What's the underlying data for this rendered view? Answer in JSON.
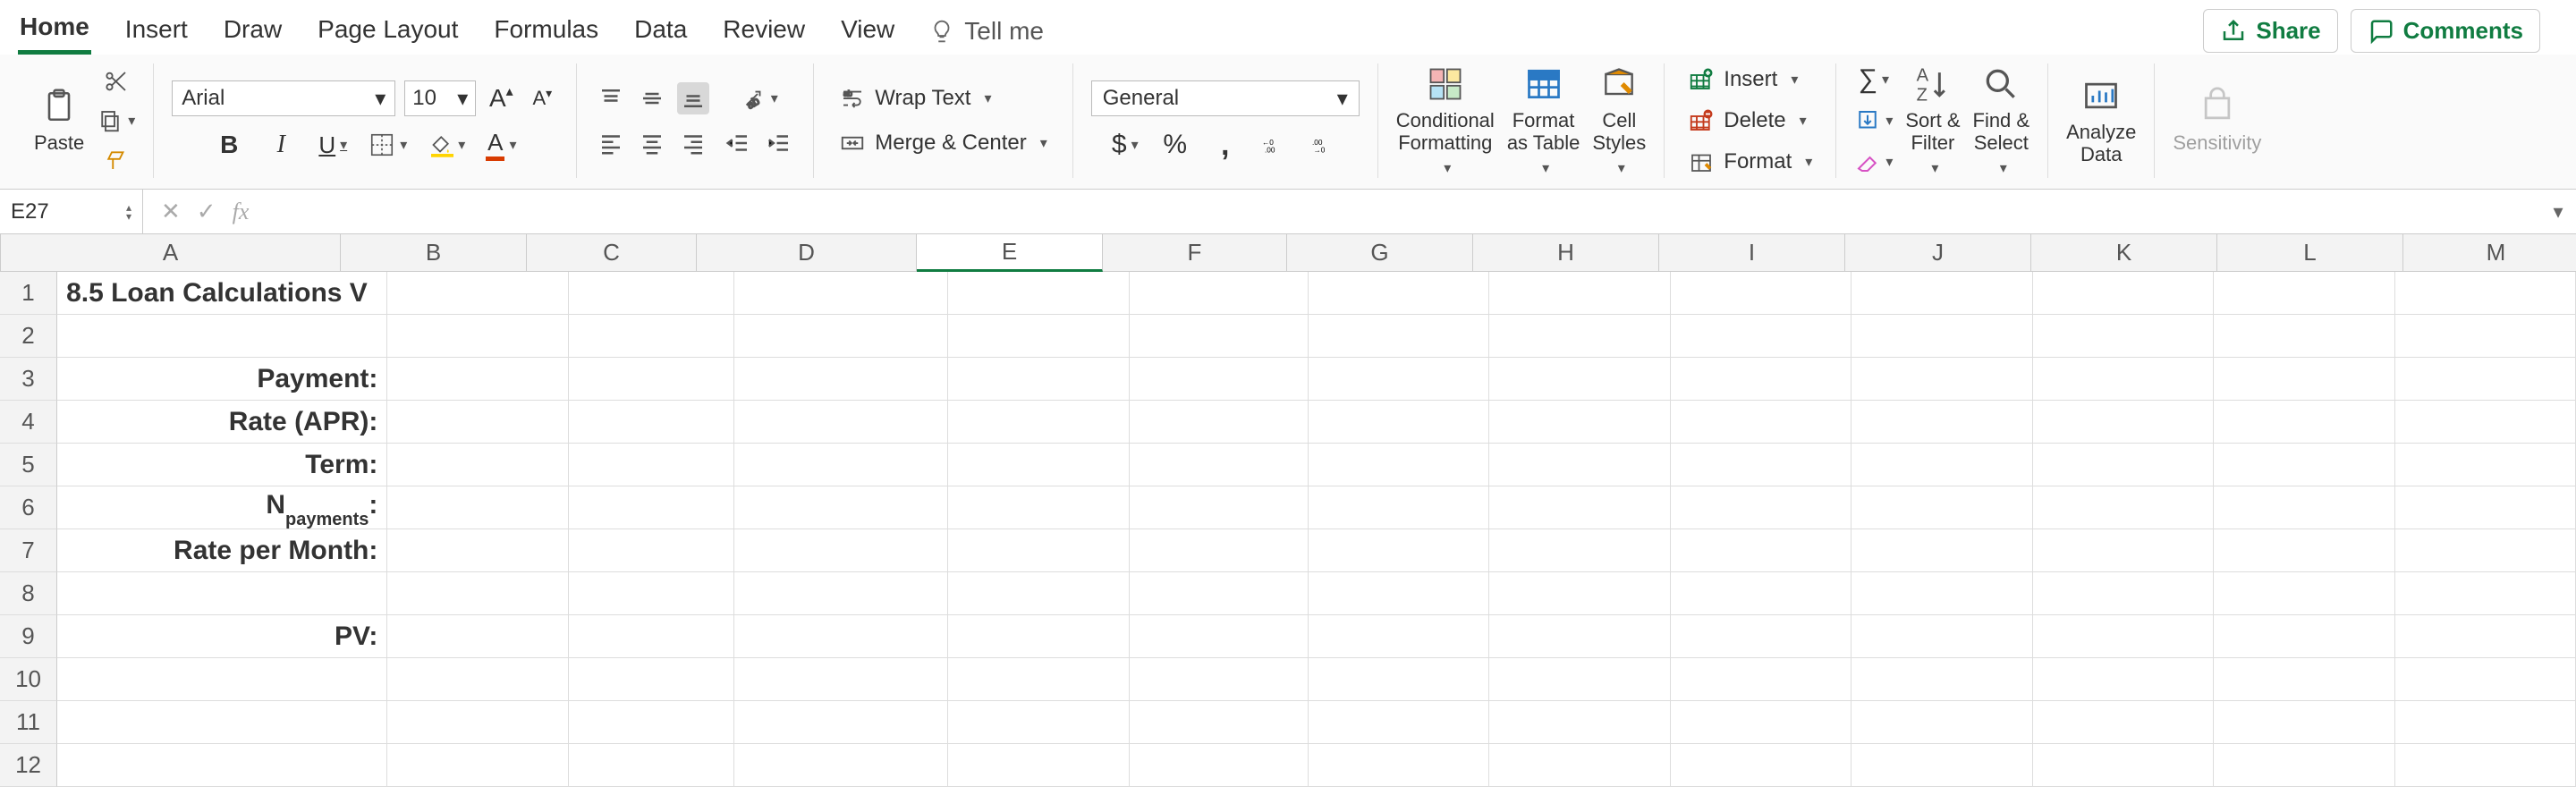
{
  "tabs": {
    "home": "Home",
    "insert": "Insert",
    "draw": "Draw",
    "page_layout": "Page Layout",
    "formulas": "Formulas",
    "data": "Data",
    "review": "Review",
    "view": "View",
    "tell_me": "Tell me"
  },
  "top_right": {
    "share": "Share",
    "comments": "Comments"
  },
  "clipboard": {
    "paste": "Paste"
  },
  "font": {
    "name": "Arial",
    "size": "10"
  },
  "alignment": {
    "wrap_text": "Wrap Text",
    "merge_center": "Merge & Center"
  },
  "number": {
    "format": "General"
  },
  "styles": {
    "conditional_formatting": "Conditional\nFormatting",
    "format_as_table": "Format\nas Table",
    "cell_styles": "Cell\nStyles"
  },
  "cells": {
    "insert": "Insert",
    "delete": "Delete",
    "format": "Format"
  },
  "editing": {
    "sort_filter": "Sort &\nFilter",
    "find_select": "Find &\nSelect"
  },
  "analyze": {
    "label": "Analyze\nData"
  },
  "sensitivity": {
    "label": "Sensitivity"
  },
  "name_box": "E27",
  "formula": "",
  "columns": [
    "A",
    "B",
    "C",
    "D",
    "E",
    "F",
    "G",
    "H",
    "I",
    "J",
    "K",
    "L",
    "M"
  ],
  "selected_col": "E",
  "sheet": {
    "a1": "8.5 Loan Calculations V",
    "a3": "Payment:",
    "a4": "Rate (APR):",
    "a5": "Term:",
    "a6_pre": "N",
    "a6_sub": "payments",
    "a6_post": ":",
    "a7": "Rate per Month:",
    "a9": "PV:"
  },
  "visible_rows": 12
}
